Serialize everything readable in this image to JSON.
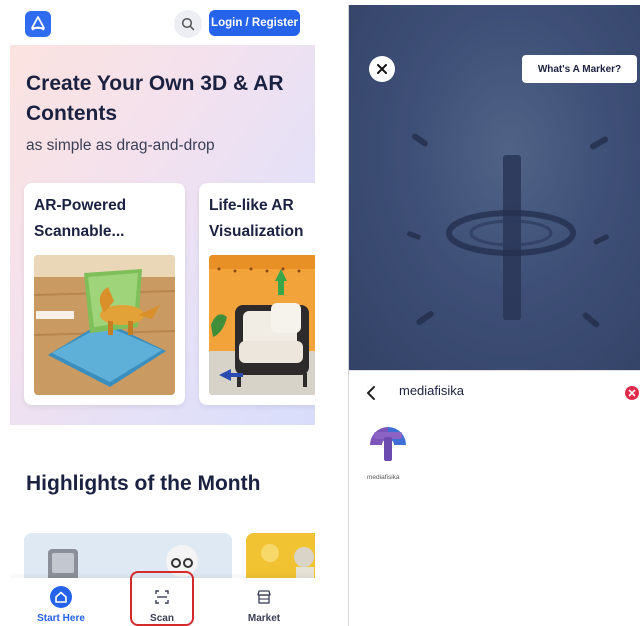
{
  "left_app": {
    "header": {
      "login_label": "Login / Register"
    },
    "hero": {
      "title": "Create Your Own 3D & AR Contents",
      "subtitle": "as simple as drag-and-drop",
      "cards": [
        {
          "title": "AR-Powered\nScannable..."
        },
        {
          "title": "Life-like AR\nVisualization"
        }
      ]
    },
    "highlights_title": "Highlights of the Month",
    "bottom_nav": [
      {
        "label": "Start Here",
        "icon": "home-icon",
        "active": true
      },
      {
        "label": "Scan",
        "icon": "scan-icon",
        "active": false
      },
      {
        "label": "Market",
        "icon": "market-icon",
        "active": false
      }
    ],
    "colors": {
      "primary": "#2563eb",
      "highlight_box": "#d42a2a"
    }
  },
  "right_app": {
    "marker_button_label": "What's A Marker?",
    "sheet": {
      "title": "mediafisika",
      "channels": [
        {
          "name": "mediafisika",
          "icon": "mediafisika-logo"
        }
      ]
    },
    "colors": {
      "close_accent": "#e22a4b"
    }
  }
}
